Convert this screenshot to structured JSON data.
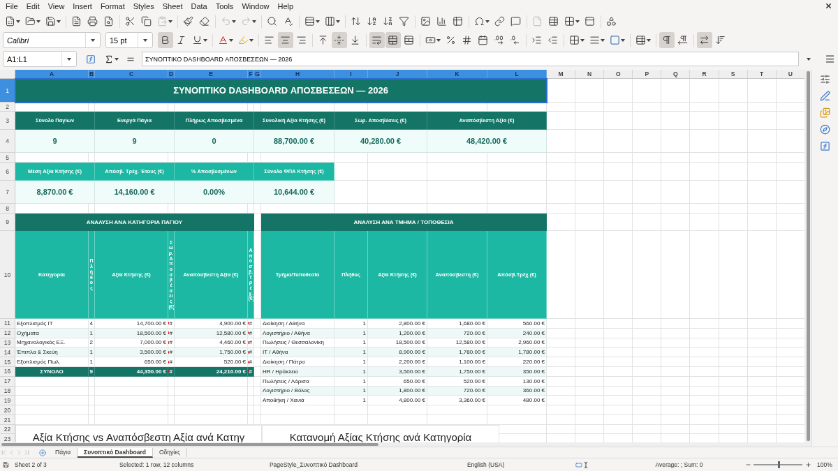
{
  "menu": [
    "File",
    "Edit",
    "View",
    "Insert",
    "Format",
    "Styles",
    "Sheet",
    "Data",
    "Tools",
    "Window",
    "Help"
  ],
  "standard_toolbar": [
    {
      "kind": "new",
      "disabled": false
    },
    {
      "kind": "open",
      "disabled": false
    },
    {
      "kind": "save",
      "disabled": false
    },
    {
      "kind": "export_pdf",
      "disabled": false
    },
    {
      "kind": "print",
      "disabled": false
    },
    {
      "kind": "print_preview",
      "disabled": false
    },
    {
      "kind": "cut",
      "disabled": false
    },
    {
      "kind": "copy",
      "disabled": false
    },
    {
      "kind": "paste",
      "disabled": true
    },
    {
      "kind": "clone",
      "disabled": false
    },
    {
      "kind": "clear",
      "disabled": false
    },
    {
      "kind": "undo",
      "disabled": true
    },
    {
      "kind": "redo",
      "disabled": true
    },
    {
      "kind": "find",
      "disabled": false
    },
    {
      "kind": "spelling",
      "disabled": false
    },
    {
      "kind": "row",
      "disabled": false
    },
    {
      "kind": "column",
      "disabled": false
    },
    {
      "kind": "sort",
      "disabled": false
    },
    {
      "kind": "sort_asc",
      "disabled": false
    },
    {
      "kind": "sort_desc",
      "disabled": false
    },
    {
      "kind": "autofilter",
      "disabled": false
    },
    {
      "kind": "image",
      "disabled": false
    },
    {
      "kind": "chart",
      "disabled": false
    },
    {
      "kind": "pivot",
      "disabled": false
    },
    {
      "kind": "special_char",
      "disabled": false
    },
    {
      "kind": "hyperlink",
      "disabled": false
    },
    {
      "kind": "comment",
      "disabled": false
    },
    {
      "kind": "header_footer",
      "disabled": true
    },
    {
      "kind": "print_area",
      "disabled": false
    },
    {
      "kind": "freeze",
      "disabled": false
    },
    {
      "kind": "split",
      "disabled": false
    },
    {
      "kind": "shapes",
      "disabled": false
    }
  ],
  "font_name": "Calibri",
  "font_size": "15 pt",
  "format_toolbar": [
    {
      "kind": "bold",
      "active": true
    },
    {
      "kind": "italic",
      "active": false
    },
    {
      "kind": "underline",
      "active": false
    },
    {
      "kind": "font_color",
      "active": false
    },
    {
      "kind": "highlight",
      "active": false
    },
    {
      "kind": "align_left",
      "active": false
    },
    {
      "kind": "align_center",
      "active": true
    },
    {
      "kind": "align_right",
      "active": false
    },
    {
      "kind": "align_top",
      "active": false
    },
    {
      "kind": "align_middle",
      "active": true
    },
    {
      "kind": "align_bottom",
      "active": false
    },
    {
      "kind": "wrap",
      "active": true
    },
    {
      "kind": "merge",
      "active": true
    },
    {
      "kind": "unmerge",
      "active": false
    },
    {
      "kind": "currency",
      "active": false
    },
    {
      "kind": "percent",
      "active": false
    },
    {
      "kind": "number",
      "active": false
    },
    {
      "kind": "date",
      "active": false
    },
    {
      "kind": "add_decimal",
      "active": false
    },
    {
      "kind": "remove_decimal",
      "active": false
    },
    {
      "kind": "indent_more",
      "active": false
    },
    {
      "kind": "indent_less",
      "active": false
    },
    {
      "kind": "borders",
      "active": false
    },
    {
      "kind": "border_style",
      "active": false
    },
    {
      "kind": "border_color",
      "active": false
    },
    {
      "kind": "conditional",
      "active": false
    },
    {
      "kind": "para_ltr",
      "active": true
    },
    {
      "kind": "para_rtl",
      "active": false
    },
    {
      "kind": "text_ltr",
      "active": true
    },
    {
      "kind": "vertical_text",
      "active": false
    }
  ],
  "name_box": "A1:L1",
  "formula": "ΣΥΝΟΠΤΙΚΟ DASHBOARD ΑΠΟΣΒΕΣΕΩΝ — 2026",
  "columns": [
    {
      "label": "A",
      "selected": true
    },
    {
      "label": "B",
      "selected": true
    },
    {
      "label": "C",
      "selected": true
    },
    {
      "label": "D",
      "selected": true
    },
    {
      "label": "E",
      "selected": true
    },
    {
      "label": "F",
      "selected": true
    },
    {
      "label": "G",
      "selected": true
    },
    {
      "label": "H",
      "selected": true
    },
    {
      "label": "I",
      "selected": true
    },
    {
      "label": "J",
      "selected": true
    },
    {
      "label": "K",
      "selected": true
    },
    {
      "label": "L",
      "selected": true
    },
    {
      "label": "M",
      "selected": false
    },
    {
      "label": "N",
      "selected": false
    },
    {
      "label": "O",
      "selected": false
    },
    {
      "label": "P",
      "selected": false
    },
    {
      "label": "Q",
      "selected": false
    },
    {
      "label": "R",
      "selected": false
    },
    {
      "label": "S",
      "selected": false
    },
    {
      "label": "T",
      "selected": false
    },
    {
      "label": "U",
      "selected": false
    }
  ],
  "rows": [
    {
      "label": "1",
      "selected": true
    },
    {
      "label": "2",
      "selected": false
    },
    {
      "label": "3",
      "selected": false
    },
    {
      "label": "4",
      "selected": false
    },
    {
      "label": "5",
      "selected": false
    },
    {
      "label": "6",
      "selected": false
    },
    {
      "label": "7",
      "selected": false
    },
    {
      "label": "8",
      "selected": false
    },
    {
      "label": "9",
      "selected": false
    },
    {
      "label": "10",
      "selected": false
    },
    {
      "label": "11",
      "selected": false
    },
    {
      "label": "12",
      "selected": false
    },
    {
      "label": "13",
      "selected": false
    },
    {
      "label": "14",
      "selected": false
    },
    {
      "label": "15",
      "selected": false
    },
    {
      "label": "16",
      "selected": false
    },
    {
      "label": "17",
      "selected": false
    },
    {
      "label": "18",
      "selected": false
    },
    {
      "label": "19",
      "selected": false
    },
    {
      "label": "20",
      "selected": false
    },
    {
      "label": "21",
      "selected": false
    },
    {
      "label": "22",
      "selected": false
    },
    {
      "label": "23",
      "selected": false
    }
  ],
  "title": "ΣΥΝΟΠΤΙΚΟ DASHBOARD ΑΠΟΣΒΕΣΕΩΝ — 2026",
  "kpis_primary": [
    {
      "label": "Σύνολο Παγίων",
      "value": "9"
    },
    {
      "label": "Ενεργά Πάγια",
      "value": "9"
    },
    {
      "label": "Πλήρως Αποσβεσμένα",
      "value": "0"
    },
    {
      "label": "Συνολική Αξία Κτήσης (€)",
      "value": "88,700.00 €"
    },
    {
      "label": "Σωρ. Αποσβέσεις (€)",
      "value": "40,280.00 €"
    },
    {
      "label": "Αναπόσβεστη Αξία (€)",
      "value": "48,420.00 €"
    }
  ],
  "kpis_secondary": [
    {
      "label": "Μέση Αξία Κτήσης (€)",
      "value": "8,870.00 €"
    },
    {
      "label": "Απόσβ. Τρέχ. Έτους (€)",
      "value": "14,160.00 €"
    },
    {
      "label": "% Αποσβεσμένων",
      "value": "0.00%"
    },
    {
      "label": "Σύνολο ΦΠΑ Κτήσης (€)",
      "value": "10,644.00 €"
    }
  ],
  "category_table": {
    "title": "ΑΝΑΛΥΣΗ ΑΝΑ ΚΑΤΗΓΟΡΙΑ ΠΑΓΙΟΥ",
    "columns": [
      {
        "label": "Κατηγορία",
        "kind": "normal"
      },
      {
        "label": "Πλήθος",
        "kind": "vertical"
      },
      {
        "label": "Αξία Κτήσης (€)",
        "kind": "normal"
      },
      {
        "label": "Σωρ.Αποσβέσεις(€)",
        "kind": "vertical"
      },
      {
        "label": "Αναπόσβεστη Αξία (€)",
        "kind": "normal"
      },
      {
        "label": "Απόσβ.Τρέχ.(€)",
        "kind": "vertical"
      }
    ],
    "rows": [
      [
        "Εξοπλισμός IT",
        "4",
        "14,700.00 €",
        "#",
        "4,900.00 €",
        "#"
      ],
      [
        "Οχήματα",
        "1",
        "18,500.00 €",
        "#",
        "12,580.00 €",
        "#"
      ],
      [
        "Μηχανολογικός ΕΞ.",
        "2",
        "7,000.00 €",
        "#",
        "4,460.00 €",
        "#"
      ],
      [
        "Έπιπλα & Σκεύη",
        "1",
        "3,500.00 €",
        "#",
        "1,750.00 €",
        "#"
      ],
      [
        "Εξοπλισμός Πωλ.",
        "1",
        "650.00 €",
        "#",
        "520.00 €",
        "#"
      ]
    ],
    "total": [
      "ΣΥΝΟΛΟ",
      "9",
      "44,350.00 €",
      "#",
      "24,210.00 €",
      "#"
    ]
  },
  "department_table": {
    "title": "ΑΝΑΛΥΣΗ ΑΝΑ ΤΜΗΜΑ / ΤΟΠΟΘΕΣΙΑ",
    "columns": [
      "Τμήμα/Τοποθεσία",
      "Πλήθος",
      "Αξία Κτήσης (€)",
      "Αναπόσβεστη (€)",
      "Απόσβ.Τρέχ.(€)"
    ],
    "rows": [
      [
        "Διοίκηση / Αθήνα",
        "1",
        "2,800.00 €",
        "1,680.00 €",
        "560.00 €"
      ],
      [
        "Λογιστήριο / Αθήνα",
        "1",
        "1,200.00 €",
        "720.00 €",
        "240.00 €"
      ],
      [
        "Πωλήσεις / Θεσσαλονίκη",
        "1",
        "18,500.00 €",
        "12,580.00 €",
        "2,960.00 €"
      ],
      [
        "IT / Αθήνα",
        "1",
        "8,900.00 €",
        "1,780.00 €",
        "1,780.00 €"
      ],
      [
        "Διοίκηση / Πάτρα",
        "1",
        "2,200.00 €",
        "1,100.00 €",
        "220.00 €"
      ],
      [
        "HR / Ηράκλειο",
        "1",
        "3,500.00 €",
        "1,750.00 €",
        "350.00 €"
      ],
      [
        "Πωλήσεις / Λάρισα",
        "1",
        "650.00 €",
        "520.00 €",
        "130.00 €"
      ],
      [
        "Λογιστήριο / Βόλος",
        "1",
        "1,800.00 €",
        "720.00 €",
        "360.00 €"
      ],
      [
        "Αποθήκη / Χανιά",
        "1",
        "4,800.00 €",
        "3,360.00 €",
        "480.00 €"
      ]
    ]
  },
  "charts": [
    {
      "title": "Αξία Κτήσης vs Αναπόσβεστη Αξία ανά Κατηγ"
    },
    {
      "title": "Κατανομή Αξίας Κτήσης ανά Κατηγορία"
    }
  ],
  "sheet_tabs": [
    {
      "label": "Πάγια",
      "selected": false
    },
    {
      "label": "Συνοπτικό Dashboard",
      "selected": true
    },
    {
      "label": "Οδηγίες",
      "selected": false
    }
  ],
  "status_bar": {
    "sheet": "Sheet 2 of 3",
    "selection": "Selected: 1 row, 12 columns",
    "page_style": "PageStyle_Συνοπτικό Dashboard",
    "language": "English (USA)",
    "summary": "Average: ; Sum: 0",
    "zoom": "100%",
    "zoom_level": {
      "level": 0.5
    }
  }
}
